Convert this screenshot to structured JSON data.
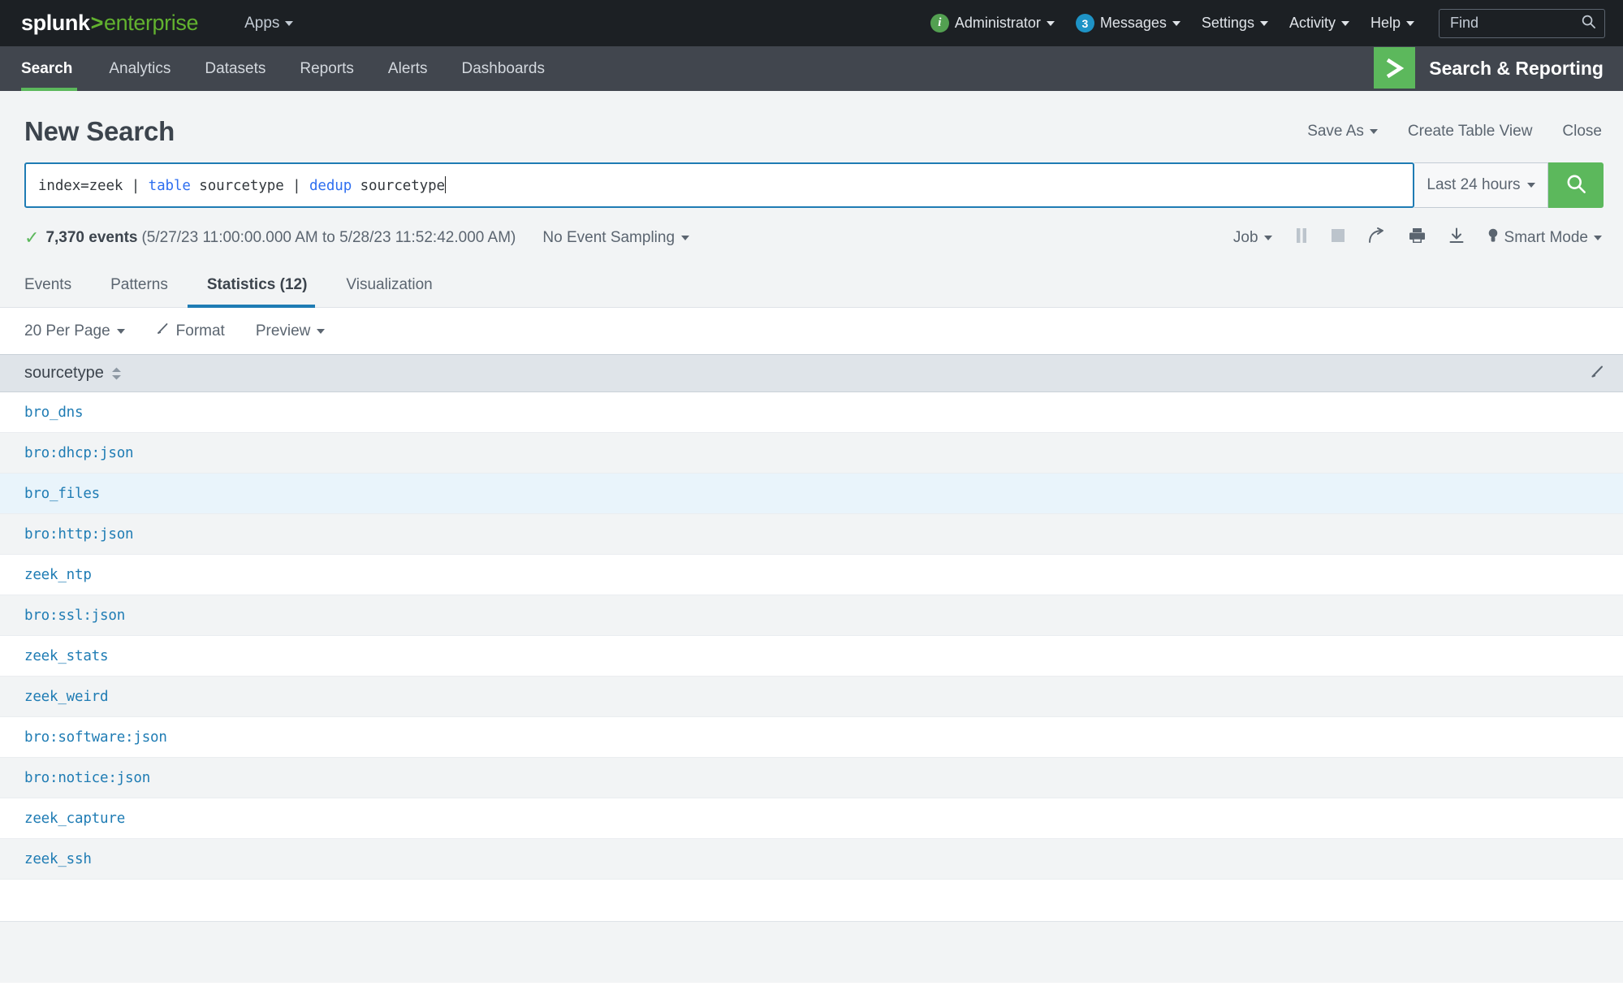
{
  "topbar": {
    "logo": {
      "brand": "splunk",
      "separator": ">",
      "edition": "enterprise"
    },
    "apps_label": "Apps",
    "info_icon_char": "i",
    "user_label": "Administrator",
    "messages_count": "3",
    "messages_label": "Messages",
    "settings_label": "Settings",
    "activity_label": "Activity",
    "help_label": "Help",
    "find_placeholder": "Find"
  },
  "appnav": {
    "items": [
      {
        "label": "Search",
        "active": true
      },
      {
        "label": "Analytics",
        "active": false
      },
      {
        "label": "Datasets",
        "active": false
      },
      {
        "label": "Reports",
        "active": false
      },
      {
        "label": "Alerts",
        "active": false
      },
      {
        "label": "Dashboards",
        "active": false
      }
    ],
    "app_name": "Search & Reporting",
    "app_icon": "chevron-right-icon"
  },
  "page": {
    "title": "New Search",
    "actions": [
      {
        "label": "Save As",
        "has_caret": true
      },
      {
        "label": "Create Table View",
        "has_caret": false
      },
      {
        "label": "Close",
        "has_caret": false
      }
    ]
  },
  "search": {
    "query_segments": [
      {
        "text": "index=zeek | ",
        "keyword": false
      },
      {
        "text": "table",
        "keyword": true
      },
      {
        "text": " sourcetype | ",
        "keyword": false
      },
      {
        "text": "dedup",
        "keyword": true
      },
      {
        "text": " sourcetype",
        "keyword": false
      }
    ],
    "query_full": "index=zeek | table sourcetype | dedup sourcetype",
    "time_range": "Last 24 hours",
    "search_button_icon": "magnifier-icon"
  },
  "status": {
    "check_icon": "check-icon",
    "event_count": "7,370 events",
    "time_range_detail": "(5/27/23 11:00:00.000 AM to 5/28/23 11:52:42.000 AM)",
    "sampling_label": "No Event Sampling",
    "job_label": "Job",
    "pause_icon": "pause-icon",
    "stop_icon": "stop-icon",
    "share_icon": "share-icon",
    "print_icon": "print-icon",
    "export_icon": "download-icon",
    "mode_icon": "lightbulb-icon",
    "mode_label": "Smart Mode"
  },
  "tabs": [
    {
      "label": "Events",
      "active": false
    },
    {
      "label": "Patterns",
      "active": false
    },
    {
      "label": "Statistics (12)",
      "active": true
    },
    {
      "label": "Visualization",
      "active": false
    }
  ],
  "table_controls": [
    {
      "label": "20 Per Page",
      "icon": "",
      "has_caret": true
    },
    {
      "label": "Format",
      "icon": "pencil-icon",
      "has_caret": false
    },
    {
      "label": "Preview",
      "icon": "",
      "has_caret": true
    }
  ],
  "table": {
    "columns": [
      "sourcetype"
    ],
    "sort_icon": "sort-arrows-icon",
    "edit_icon": "pencil-icon",
    "rows": [
      "bro_dns",
      "bro:dhcp:json",
      "bro_files",
      "bro:http:json",
      "zeek_ntp",
      "bro:ssl:json",
      "zeek_stats",
      "zeek_weird",
      "bro:software:json",
      "bro:notice:json",
      "zeek_capture",
      "zeek_ssh"
    ],
    "hovered_row_index": 2
  },
  "colors": {
    "topbar_bg": "#1c2024",
    "appnav_bg": "#41464e",
    "brand_green": "#5cb85c",
    "accent_blue": "#1f7cb4",
    "link_blue": "#1f7cb4",
    "keyword_blue": "#2f6ff0",
    "page_bg": "#f2f4f5",
    "row_alt_bg": "#f2f4f5",
    "row_hover_bg": "#e9f4fb",
    "thead_bg": "#dfe4e9"
  }
}
